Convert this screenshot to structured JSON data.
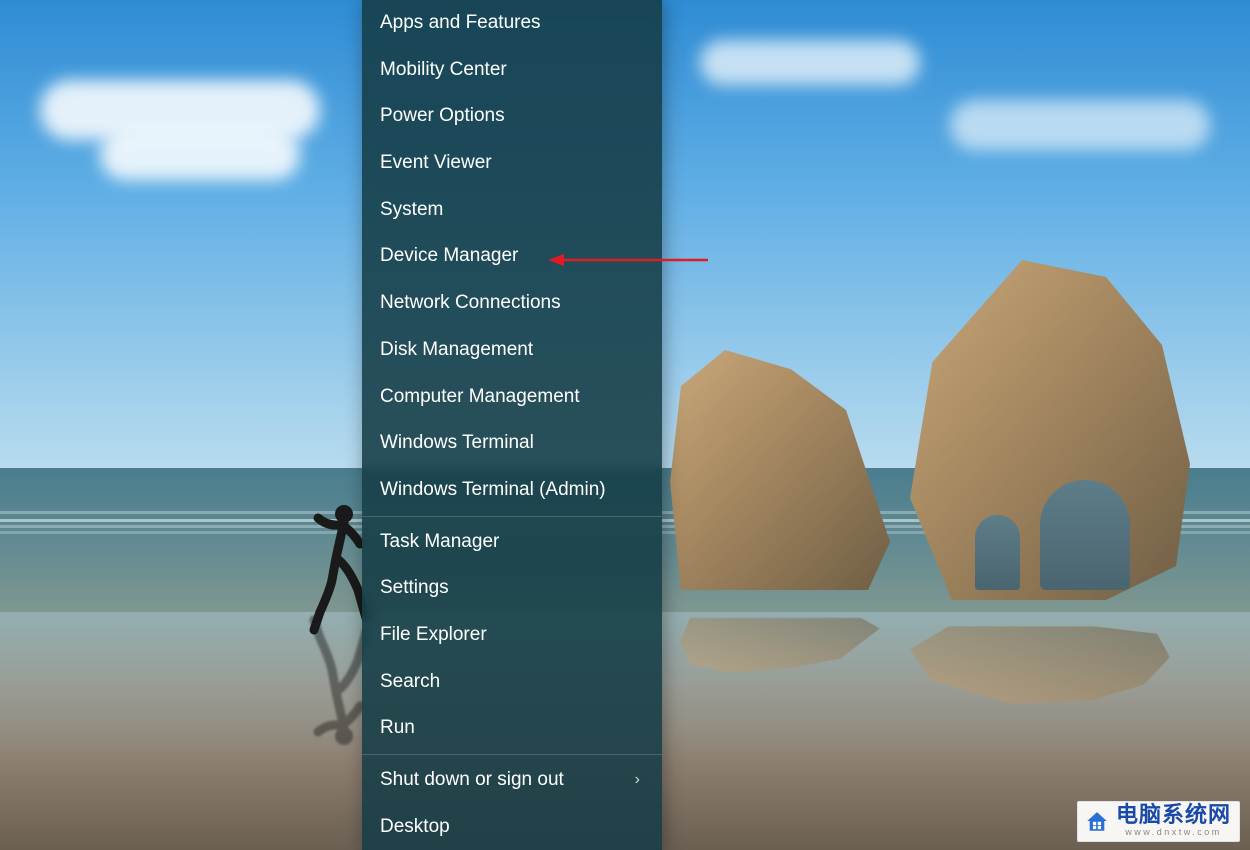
{
  "menu": {
    "groups": [
      [
        {
          "id": "apps-features",
          "label": "Apps and Features",
          "submenu": false
        },
        {
          "id": "mobility-center",
          "label": "Mobility Center",
          "submenu": false
        },
        {
          "id": "power-options",
          "label": "Power Options",
          "submenu": false
        },
        {
          "id": "event-viewer",
          "label": "Event Viewer",
          "submenu": false
        },
        {
          "id": "system",
          "label": "System",
          "submenu": false
        },
        {
          "id": "device-manager",
          "label": "Device Manager",
          "submenu": false
        },
        {
          "id": "network-connections",
          "label": "Network Connections",
          "submenu": false
        },
        {
          "id": "disk-management",
          "label": "Disk Management",
          "submenu": false
        },
        {
          "id": "computer-management",
          "label": "Computer Management",
          "submenu": false
        },
        {
          "id": "windows-terminal",
          "label": "Windows Terminal",
          "submenu": false
        },
        {
          "id": "windows-terminal-admin",
          "label": "Windows Terminal (Admin)",
          "submenu": false
        }
      ],
      [
        {
          "id": "task-manager",
          "label": "Task Manager",
          "submenu": false
        },
        {
          "id": "settings",
          "label": "Settings",
          "submenu": false
        },
        {
          "id": "file-explorer",
          "label": "File Explorer",
          "submenu": false
        },
        {
          "id": "search",
          "label": "Search",
          "submenu": false
        },
        {
          "id": "run",
          "label": "Run",
          "submenu": false
        }
      ],
      [
        {
          "id": "shutdown-signout",
          "label": "Shut down or sign out",
          "submenu": true
        },
        {
          "id": "desktop",
          "label": "Desktop",
          "submenu": false
        }
      ]
    ]
  },
  "annotation": {
    "target_item_id": "device-manager",
    "arrow_color": "#e01b24"
  },
  "watermark": {
    "title": "电脑系统网",
    "subtitle": "www.dnxtw.com"
  }
}
